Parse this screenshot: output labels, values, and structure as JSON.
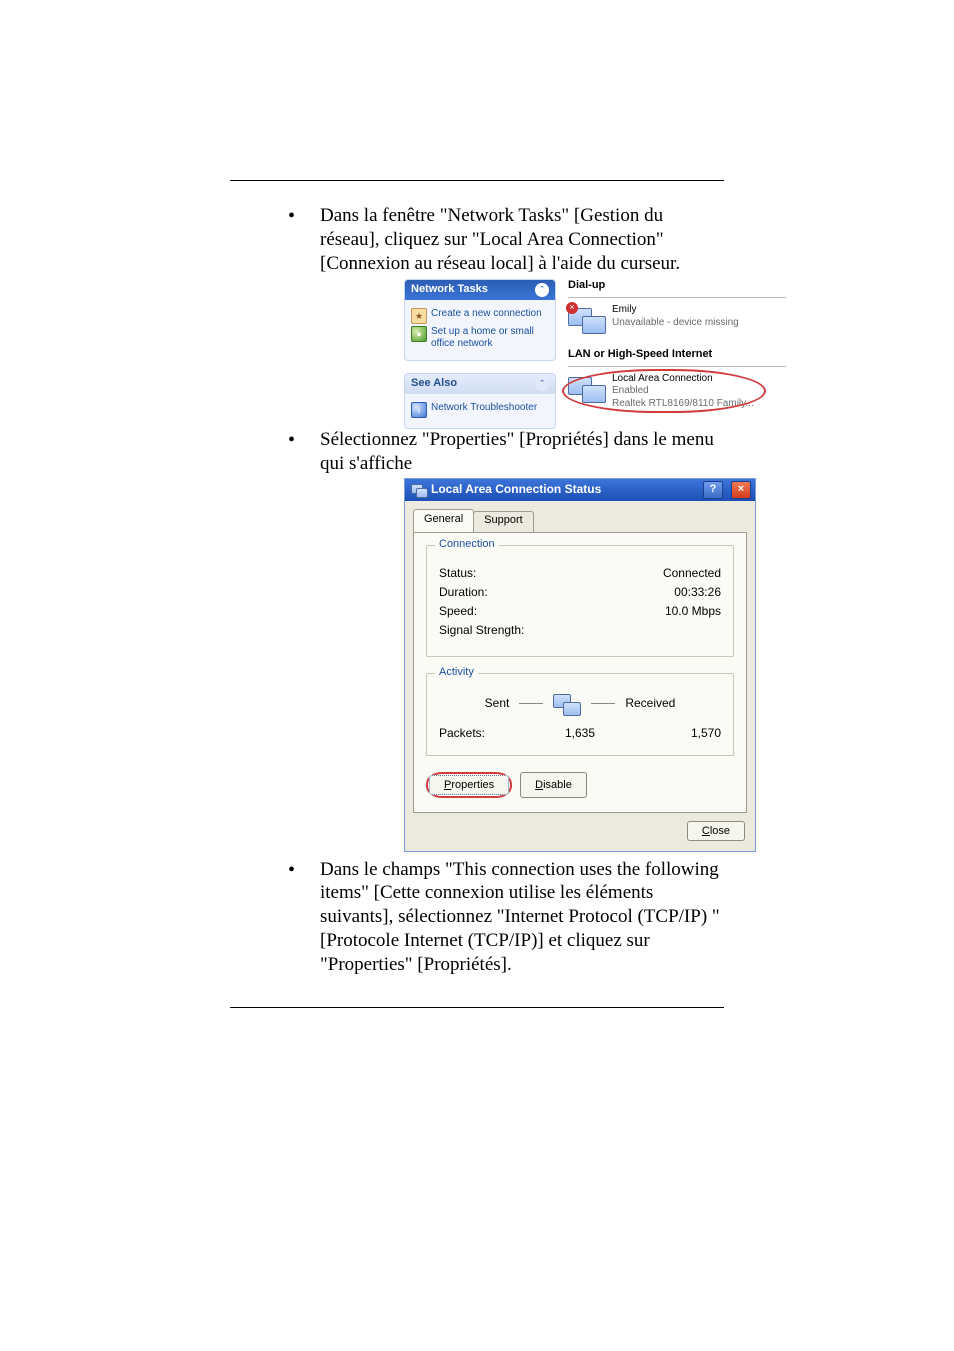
{
  "doc": {
    "bullet1": "Dans la fenêtre \"Network Tasks\" [Gestion du réseau], cliquez sur \"Local Area Connection\" [Connexion au réseau local] à l'aide du curseur.",
    "bullet2": "Sélectionnez \"Properties\" [Propriétés] dans le menu qui s'affiche",
    "bullet3": "Dans le champs \"This connection uses the following items\" [Cette connexion utilise les éléments suivants], sélectionnez \"Internet Protocol (TCP/IP) \" [Protocole Internet (TCP/IP)] et cliquez sur \"Properties\" [Propriétés]."
  },
  "shot1": {
    "network_tasks_title": "Network Tasks",
    "task_create": "Create a new connection",
    "task_setup": "Set up a home or small office network",
    "see_also_title": "See Also",
    "troubleshooter": "Network Troubleshooter",
    "cat_dialup": "Dial-up",
    "dial_name": "Emily",
    "dial_status": "Unavailable - device missing",
    "cat_lan": "LAN or High-Speed Internet",
    "lan_name": "Local Area Connection",
    "lan_status": "Enabled",
    "lan_adapter": "Realtek RTL8169/8110 Family..."
  },
  "shot2": {
    "title": "Local Area Connection Status",
    "tab_general": "General",
    "tab_support": "Support",
    "grp_connection": "Connection",
    "k_status": "Status:",
    "v_status": "Connected",
    "k_duration": "Duration:",
    "v_duration": "00:33:26",
    "k_speed": "Speed:",
    "v_speed": "10.0 Mbps",
    "k_signal": "Signal Strength:",
    "grp_activity": "Activity",
    "lbl_sent": "Sent",
    "lbl_received": "Received",
    "k_packets": "Packets:",
    "v_sent": "1,635",
    "v_recv": "1,570",
    "btn_properties": "Properties",
    "btn_disable": "Disable",
    "btn_close": "Close"
  }
}
